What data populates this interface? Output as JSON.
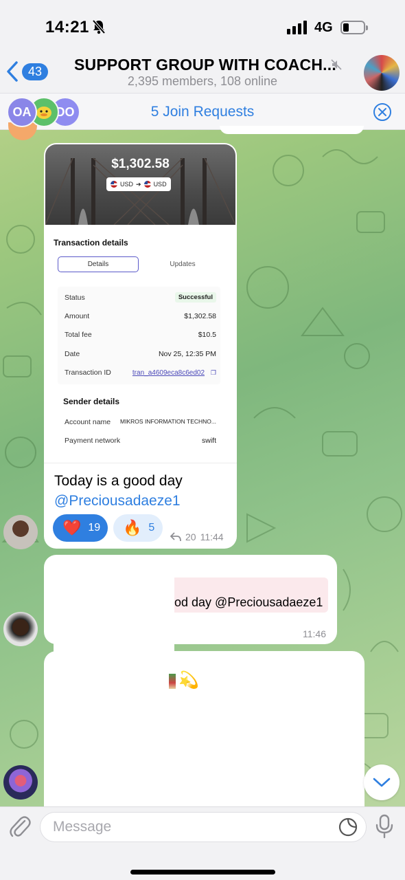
{
  "status_bar": {
    "time": "14:21",
    "network": "4G"
  },
  "header": {
    "back_count": "43",
    "title": "SUPPORT GROUP WITH COACH...",
    "subtitle": "2,395 members, 108 online"
  },
  "join_requests": {
    "avatars": [
      {
        "initials": "OA",
        "color": "#8a86e8"
      },
      {
        "initials": "",
        "color": "#5cc06a"
      },
      {
        "initials": "DO",
        "color": "#8f8cf0"
      }
    ],
    "label": "5 Join Requests"
  },
  "transaction_card": {
    "amount": "$1,302.58",
    "from_currency": "USD",
    "to_currency": "USD",
    "section_title": "Transaction details",
    "tabs": [
      "Details",
      "Updates"
    ],
    "rows": [
      {
        "key": "Status",
        "value": "Successful"
      },
      {
        "key": "Amount",
        "value": "$1,302.58"
      },
      {
        "key": "Total fee",
        "value": "$10.5"
      },
      {
        "key": "Date",
        "value": "Nov 25, 12:35 PM"
      },
      {
        "key": "Transaction ID",
        "value": "tran_a4609eca8c6ed02"
      }
    ],
    "sender_title": "Sender details",
    "sender_rows": [
      {
        "key": "Account name",
        "value": "MIKROS INFORMATION TECHNO..."
      },
      {
        "key": "Payment network",
        "value": "swift"
      }
    ]
  },
  "message1": {
    "text": "Today is a good day",
    "mention": "@Preciousadaeze1",
    "reactions": [
      {
        "emoji": "❤️",
        "count": "19"
      },
      {
        "emoji": "🔥",
        "count": "5"
      }
    ],
    "forwards": "20",
    "time": "11:44"
  },
  "message2": {
    "reply_text": "od day @Preciousadaeze1",
    "time": "11:46"
  },
  "message3": {
    "emoji": "💫"
  },
  "input": {
    "placeholder": "Message"
  },
  "colors": {
    "accent": "#2f7fe0",
    "success": "#2d8a3c",
    "link": "#4a48b8"
  }
}
